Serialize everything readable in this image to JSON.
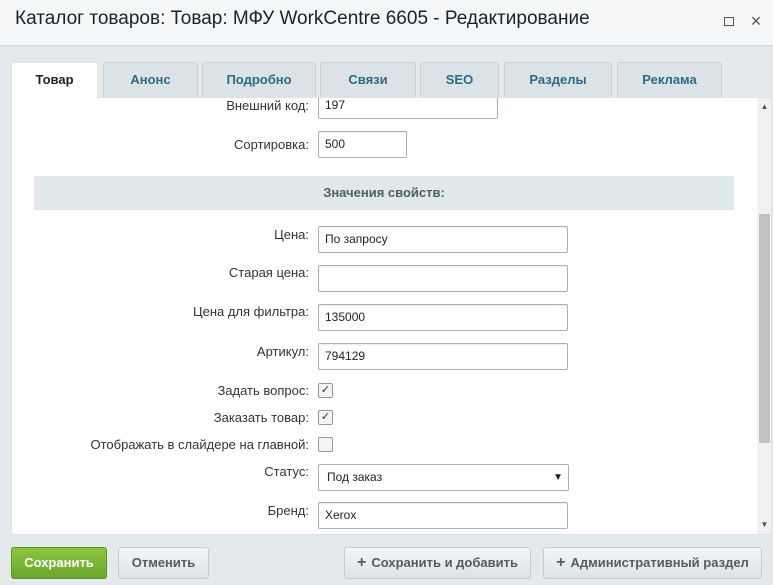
{
  "window": {
    "title": "Каталог товаров: Товар: МФУ WorkCentre 6605 - Редактирование",
    "maximize_icon": "maximize-icon",
    "close_icon": "close-icon",
    "close_glyph": "×"
  },
  "tabs": [
    {
      "label": "Товар",
      "active": true
    },
    {
      "label": "Анонс",
      "active": false
    },
    {
      "label": "Подробно",
      "active": false
    },
    {
      "label": "Связи",
      "active": false
    },
    {
      "label": "SEO",
      "active": false
    },
    {
      "label": "Разделы",
      "active": false
    },
    {
      "label": "Реклама",
      "active": false
    }
  ],
  "form": {
    "external_code": {
      "label": "Внешний код:",
      "value": "197"
    },
    "sort": {
      "label": "Сортировка:",
      "value": "500"
    },
    "section_title": "Значения свойств:",
    "price": {
      "label": "Цена:",
      "value": "По запросу"
    },
    "old_price": {
      "label": "Старая цена:",
      "value": ""
    },
    "filter_price": {
      "label": "Цена для фильтра:",
      "value": "135000"
    },
    "article": {
      "label": "Артикул:",
      "value": "794129"
    },
    "ask_question": {
      "label": "Задать вопрос:",
      "checked": true
    },
    "order_item": {
      "label": "Заказать товар:",
      "checked": true
    },
    "show_in_slider": {
      "label": "Отображать в слайдере на главной:",
      "checked": false
    },
    "status": {
      "label": "Статус:",
      "value": "Под заказ"
    },
    "brand": {
      "label": "Бренд:",
      "value": "Xerox"
    },
    "check_glyph": "✓",
    "dropdown_arrow": "▼"
  },
  "scrollbar": {
    "up_arrow": "▲",
    "down_arrow": "▼"
  },
  "buttons": {
    "save": "Сохранить",
    "cancel": "Отменить",
    "save_and_add": "Сохранить и добавить",
    "admin_section": "Административный раздел",
    "plus_glyph": "+"
  },
  "colors": {
    "save_button": "#7ab534",
    "tab_text": "#2f6a83",
    "section_bg": "#e0e8ea"
  }
}
